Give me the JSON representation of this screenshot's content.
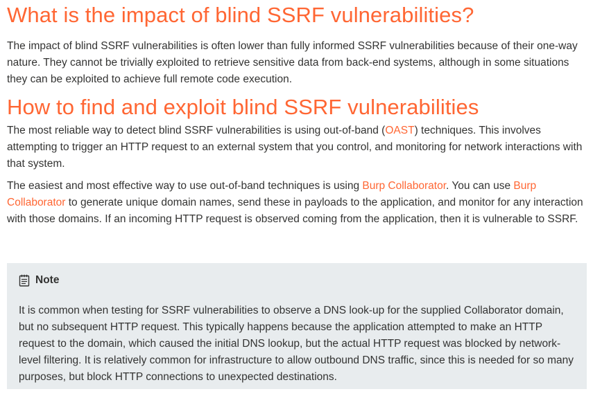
{
  "section_impact": {
    "heading": "What is the impact of blind SSRF vulnerabilities?",
    "paragraph": "The impact of blind SSRF vulnerabilities is often lower than fully informed SSRF vulnerabilities because of their one-way nature. They cannot be trivially exploited to retrieve sensitive data from back-end systems, although in some situations they can be exploited to achieve full remote code execution."
  },
  "section_find": {
    "heading": "How to find and exploit blind SSRF vulnerabilities",
    "detect": {
      "before": "The most reliable way to detect blind SSRF vulnerabilities is using out-of-band (",
      "link": "OAST",
      "after": ") techniques. This involves attempting to trigger an HTTP request to an external system that you control, and monitoring for network interactions with that system."
    },
    "easiest": {
      "part1": "The easiest and most effective way to use out-of-band techniques is using ",
      "link1": "Burp Collaborator",
      "part2": ". You can use ",
      "link2": "Burp Collaborator",
      "part3": " to generate unique domain names, send these in payloads to the application, and monitor for any interaction with those domains. If an incoming HTTP request is observed coming from the application, then it is vulnerable to SSRF."
    }
  },
  "note": {
    "icon": "note-icon",
    "title": "Note",
    "body": "It is common when testing for SSRF vulnerabilities to observe a DNS look-up for the supplied Collaborator domain, but no subsequent HTTP request. This typically happens because the application attempted to make an HTTP request to the domain, which caused the initial DNS lookup, but the actual HTTP request was blocked by network-level filtering. It is relatively common for infrastructure to allow outbound DNS traffic, since this is needed for so many purposes, but block HTTP connections to unexpected destinations."
  },
  "colors": {
    "accent": "#ff6633",
    "text": "#333332",
    "note_background": "#e8ecee"
  }
}
